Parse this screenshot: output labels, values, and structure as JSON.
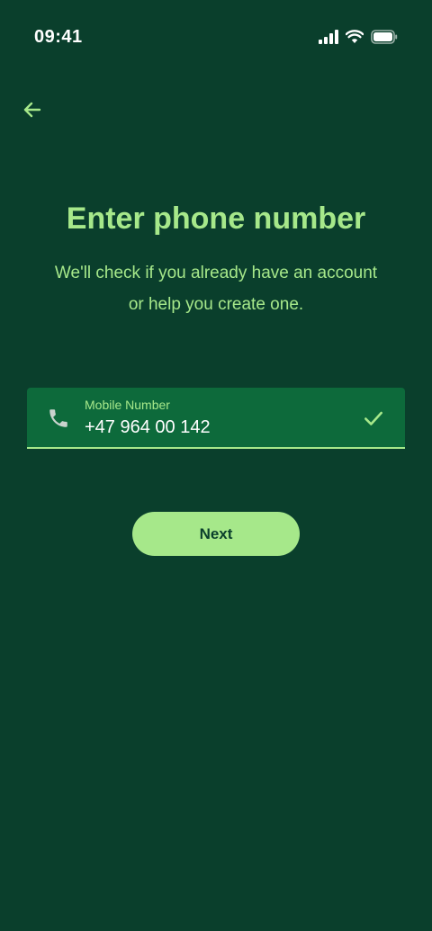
{
  "status_bar": {
    "time": "09:41",
    "icons": [
      "cellular-signal-icon",
      "wifi-icon",
      "battery-icon"
    ]
  },
  "nav": {
    "back_icon": "arrow-left-icon"
  },
  "header": {
    "title": "Enter phone number",
    "subtitle": "We'll check if you already have an account or help you create one."
  },
  "phone_field": {
    "label": "Mobile Number",
    "value": "+47 964 00 142",
    "leading_icon": "phone-icon",
    "trailing_icon": "check-icon"
  },
  "actions": {
    "next_label": "Next"
  },
  "colors": {
    "background": "#0a3f2c",
    "field_background": "#0d6a3b",
    "accent": "#a6e88a",
    "text_light": "#ffffff"
  }
}
